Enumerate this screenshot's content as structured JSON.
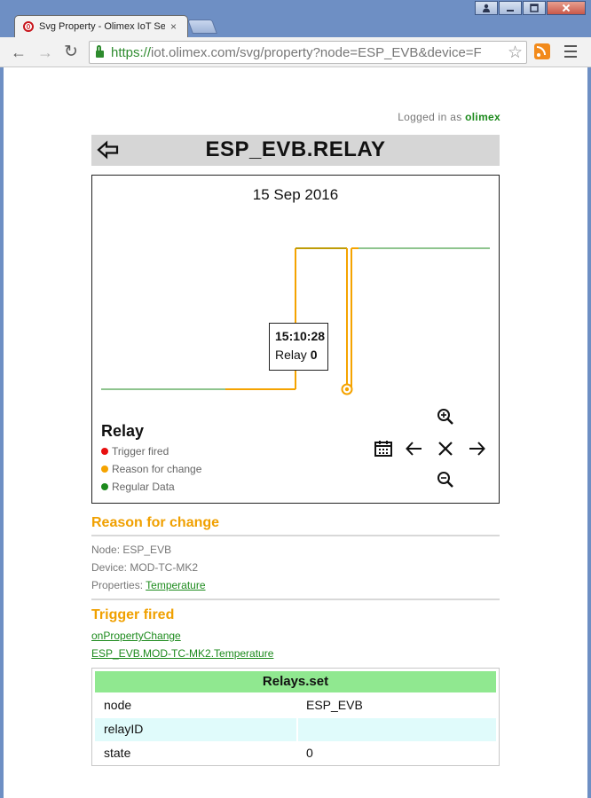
{
  "browser": {
    "tab_title": "Svg Property - Olimex IoT Se",
    "tab_close": "×",
    "url_scheme": "https://",
    "url_rest": "iot.olimex.com/svg/property?node=ESP_EVB&device=F"
  },
  "page": {
    "logged_in_prefix": "Logged in as",
    "logged_in_user": "olimex",
    "title": "ESP_EVB.RELAY",
    "chart": {
      "date": "15 Sep 2016",
      "tooltip_time": "15:10:28",
      "tooltip_label": "Relay",
      "tooltip_value": "0",
      "legend_title": "Relay",
      "legend": [
        {
          "label": "Trigger fired",
          "color": "#e81010"
        },
        {
          "label": "Reason for change",
          "color": "#f5a300"
        },
        {
          "label": "Regular Data",
          "color": "#1c8a1c"
        }
      ]
    },
    "reason": {
      "heading": "Reason for change",
      "node_label": "Node:",
      "node_value": "ESP_EVB",
      "device_label": "Device:",
      "device_value": "MOD-TC-MK2",
      "properties_label": "Properties:",
      "properties_value": "Temperature"
    },
    "trigger": {
      "heading": "Trigger fired",
      "link1": "onPropertyChange",
      "link2": "ESP_EVB.MOD-TC-MK2.Temperature"
    },
    "relays_table": {
      "title": "Relays.set",
      "rows": [
        {
          "key": "node",
          "value": "ESP_EVB"
        },
        {
          "key": "relayID",
          "value": ""
        },
        {
          "key": "state",
          "value": "0"
        }
      ]
    }
  },
  "colors": {
    "accent_orange": "#f0a000",
    "link_green": "#1c8a1c",
    "table_header": "#90e890",
    "table_alt_row": "#e0fbfb",
    "browser_frame": "#6e8fc4"
  }
}
